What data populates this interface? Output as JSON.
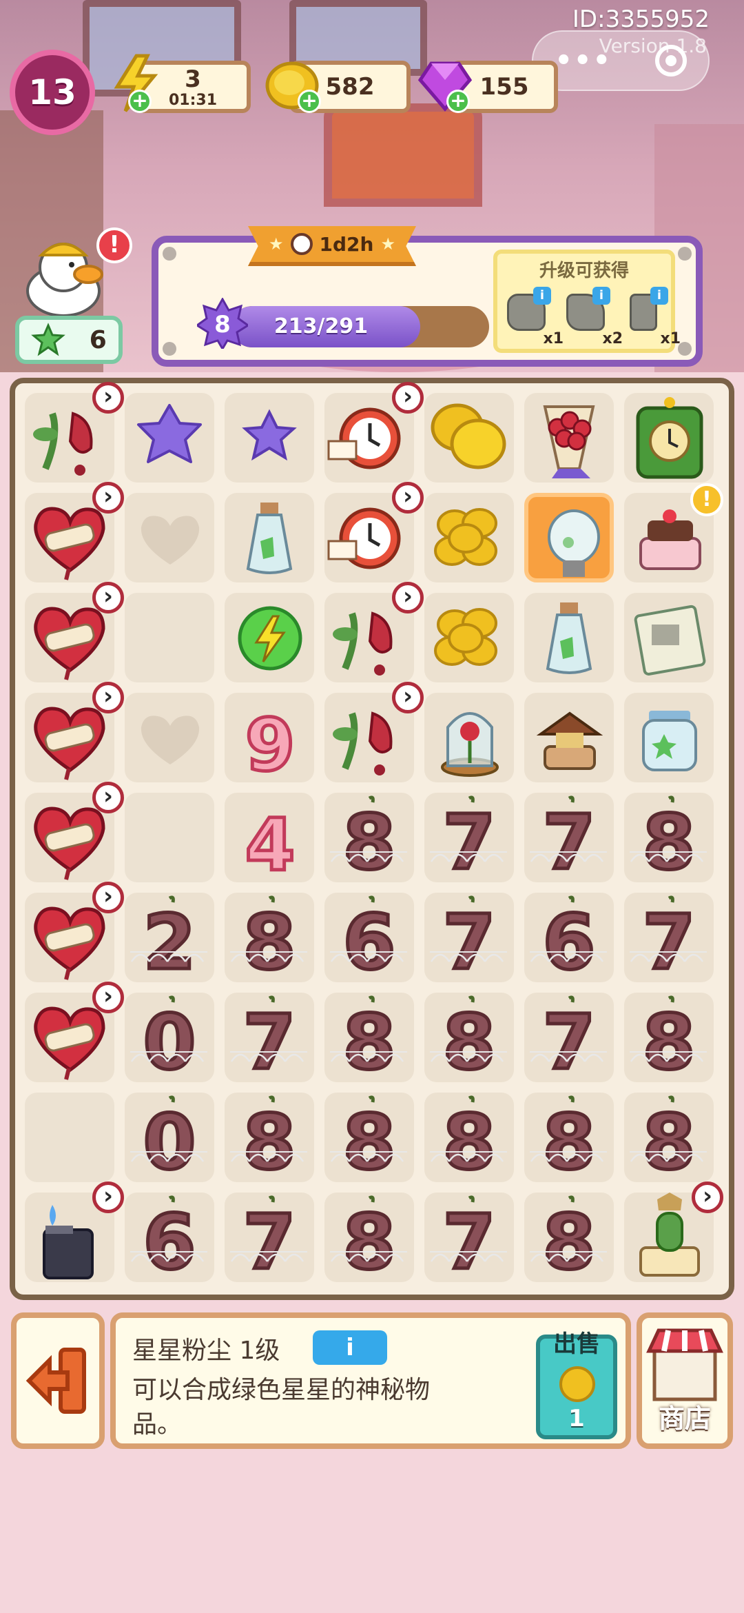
{
  "header": {
    "user_id": "ID:3355952",
    "version": "Version 1.8",
    "player_level": "13"
  },
  "resources": {
    "energy": {
      "value": "3",
      "timer": "01:31",
      "icon": "lightning-icon"
    },
    "coins": {
      "value": "582",
      "icon": "coin-icon"
    },
    "gems": {
      "value": "155",
      "icon": "gem-icon"
    }
  },
  "duck": {
    "count": "6",
    "icon": "clover-icon",
    "alert": "!"
  },
  "level_panel": {
    "timer": "1d2h",
    "level": "8",
    "progress_text": "213/291",
    "progress_fraction": 0.732,
    "reward_title": "升级可获得",
    "rewards": [
      {
        "icon": "stone-rock-icon",
        "count": "x1",
        "info": "i"
      },
      {
        "icon": "stone-rubble-icon",
        "count": "x2",
        "info": "i"
      },
      {
        "icon": "stone-pillar-icon",
        "count": "x1",
        "info": "i"
      }
    ]
  },
  "board": {
    "rows": [
      [
        "wilted-rose",
        "star-dust",
        "star-dust-small",
        "alarm-clock",
        "coins-pile",
        "rose-bouquet",
        "green-clock"
      ],
      [
        "bandaged-heart",
        "empty-heart",
        "bottle-green",
        "alarm-clock",
        "coin-stack",
        "lightbulb",
        "cake"
      ],
      [
        "bandaged-heart",
        "empty",
        "energy-orb",
        "wilted-rose",
        "coin-stack-big",
        "bottle-star",
        "newspaper"
      ],
      [
        "bandaged-heart",
        "empty-heart",
        "candle-9",
        "wilted-rose",
        "rose-dome",
        "music-box",
        "star-jar"
      ],
      [
        "bandaged-heart",
        "empty",
        "candle-4",
        "webbed-8",
        "webbed-7",
        "webbed-7",
        "webbed-8"
      ],
      [
        "bandaged-heart",
        "webbed-2",
        "webbed-8",
        "webbed-6",
        "webbed-7",
        "webbed-6",
        "webbed-7"
      ],
      [
        "bandaged-heart",
        "webbed-0",
        "webbed-7",
        "webbed-8",
        "webbed-8",
        "webbed-7",
        "webbed-8"
      ],
      [
        "empty",
        "webbed-0",
        "webbed-8",
        "webbed-8",
        "webbed-8",
        "webbed-8",
        "webbed-8"
      ],
      [
        "lighter",
        "webbed-6",
        "webbed-7",
        "webbed-8",
        "webbed-7",
        "webbed-8",
        "cactus-june"
      ]
    ]
  },
  "selected_item": {
    "name": "星星粉尘 1级",
    "info_label": "i",
    "description": "可以合成绿色星星的神秘物品。",
    "sell_label": "出售",
    "sell_price": "1"
  },
  "nav": {
    "exit_icon": "exit-icon",
    "shop_label": "商店",
    "shop_icon": "shop-icon"
  },
  "colors": {
    "accent_purple": "#8a5ab8",
    "board_border": "#7a6248",
    "sell_teal": "#48c9c6",
    "info_blue": "#35a9ea"
  }
}
